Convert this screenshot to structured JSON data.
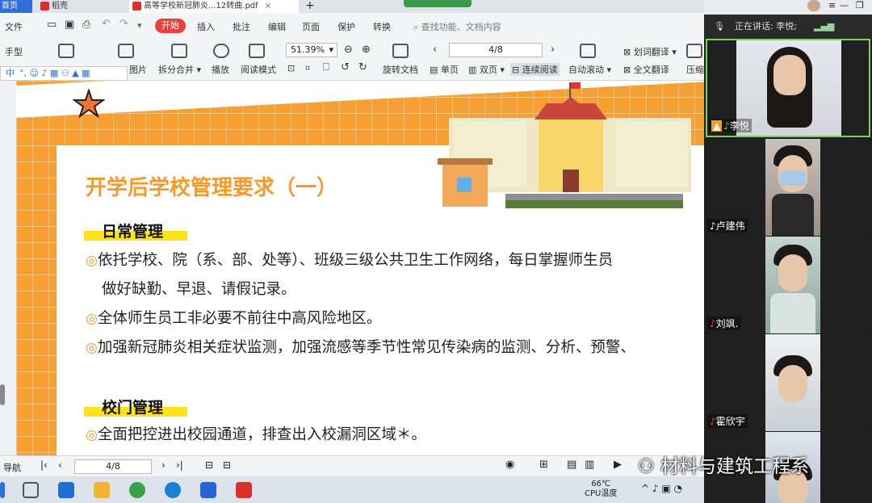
{
  "tabs": {
    "home": "首页",
    "docer": "稻壳",
    "pdf": "高等学校新冠肺炎...12转曲.pdf",
    "add": "+"
  },
  "menu": {
    "file": "文件",
    "start": "开始",
    "insert": "插入",
    "annotate": "批注",
    "edit": "编辑",
    "page": "页面",
    "protect": "保护",
    "convert": "转换",
    "search_placeholder": "查找功能、文档内容"
  },
  "toolbar": {
    "hand": "手型",
    "image": "图片",
    "split_merge": "拆分合并",
    "play": "播放",
    "read_mode": "阅读模式",
    "zoom": "51.39%",
    "page_indicator": "4/8",
    "rotate": "旋转文档",
    "single": "单页",
    "double": "双页",
    "continuous": "连续阅读",
    "auto_scroll": "自动滚动",
    "word_translate": "划词翻译",
    "full_translate": "全文翻译",
    "compress": "压缩"
  },
  "ime": "中",
  "slide": {
    "title": "开学后学校管理要求（一）",
    "section1": "日常管理",
    "s1_items": [
      "依托学校、院（系、部、处等）、班级三级公共卫生工作网络，每日掌握师生员",
      "做好缺勤、早退、请假记录。",
      "全体师生员工非必要不前往中高风险地区。",
      "加强新冠肺炎相关症状监测，加强流感等季节性常见传染病的监测、分析、预警、"
    ],
    "section2": "校门管理",
    "s2_items": [
      "全面把控进出校园通道，排查出入校漏洞区域＊。"
    ],
    "bullet": "◎"
  },
  "statusbar": {
    "nav": "导航",
    "page": "4/8"
  },
  "taskbar": {
    "temp": "66℃",
    "cpu": "CPU温度"
  },
  "meeting": {
    "speaking_label": "正在讲话: 李悦;",
    "participants": [
      {
        "name": "李悦"
      },
      {
        "name": "卢建伟"
      },
      {
        "name": "刘飒."
      },
      {
        "name": "霍欣宇"
      },
      {
        "name": ""
      }
    ]
  },
  "watermark": "材料与建筑工程系",
  "colors": {
    "accent": "#e8413a",
    "slide_orange": "#f6a033",
    "title_orange": "#f39a2b",
    "highlight": "#ffe21a",
    "tab_blue": "#2f6fd8"
  }
}
